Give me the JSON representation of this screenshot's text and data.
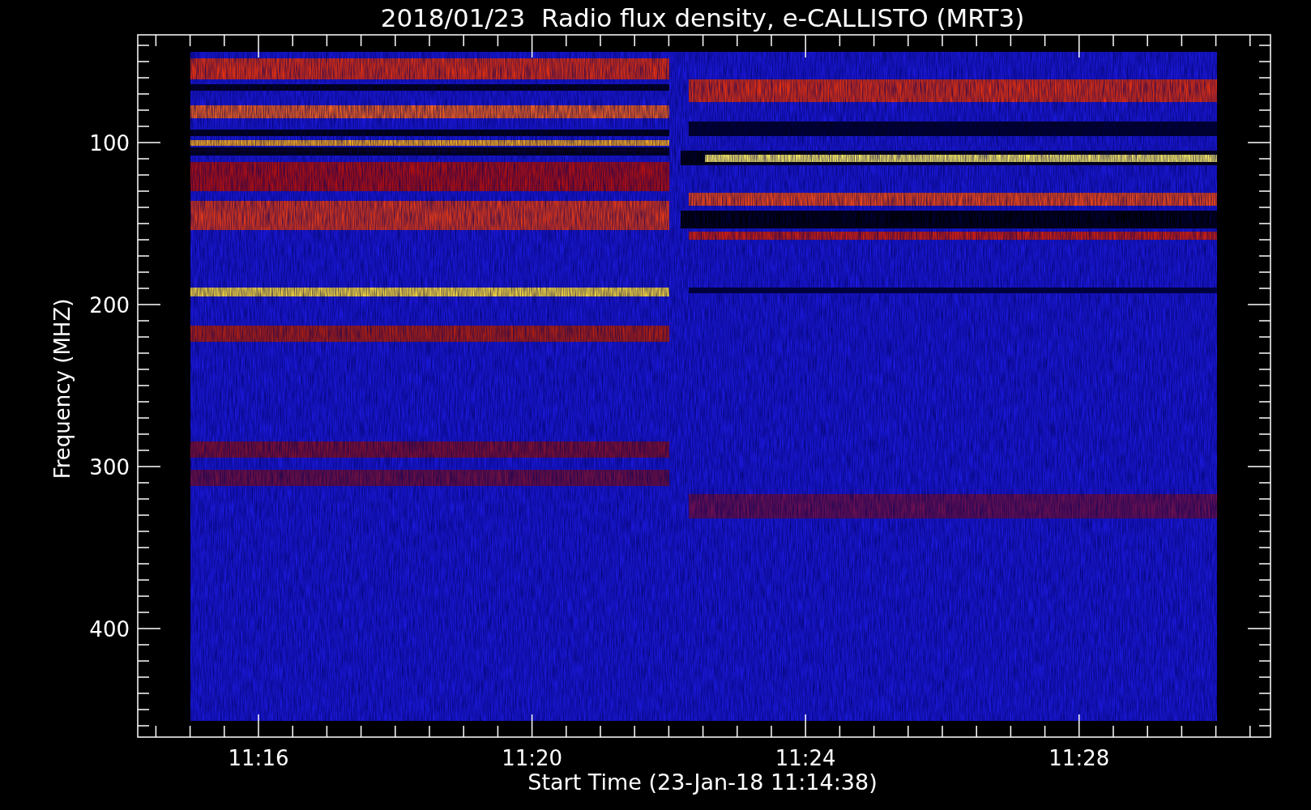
{
  "title": "2018/01/23  Radio flux density, e-CALLISTO (MRT3)",
  "x_axis": {
    "label": "Start Time (23-Jan-18 11:14:38)",
    "ticks": [
      "11:16",
      "11:20",
      "11:24",
      "11:28"
    ]
  },
  "y_axis": {
    "label": "Frequency (MHZ)",
    "ticks": [
      "100",
      "200",
      "300",
      "400"
    ]
  }
}
